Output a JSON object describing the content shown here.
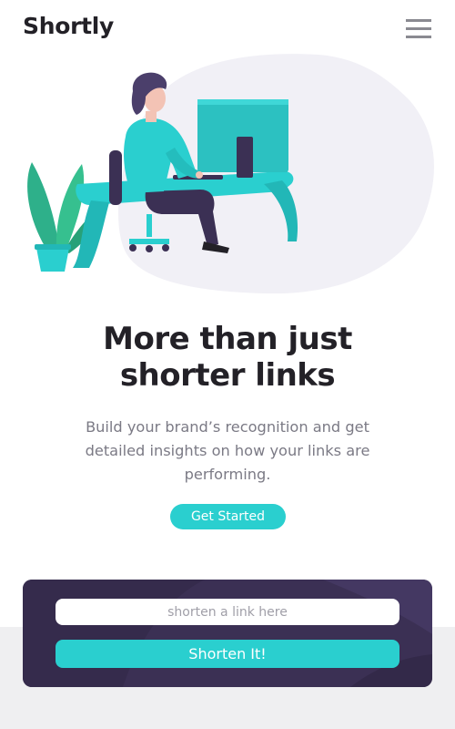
{
  "header": {
    "logo_text": "Shortly",
    "menu_icon": "hamburger-menu-icon"
  },
  "hero": {
    "illustration": "person-working-at-desk-illustration",
    "title_line1": "More than just",
    "title_line2": "shorter links",
    "description": "Build your brand’s recognition and get detailed insights on how your links are performing.",
    "cta_label": "Get Started"
  },
  "shorten": {
    "placeholder": "shorten a link here",
    "value": "",
    "button_label": "Shorten It!"
  },
  "colors": {
    "accent_cyan": "#2acfcf",
    "dark_violet": "#3b3054",
    "heading_dark": "#232127",
    "text_gray": "#7b7a85",
    "band_gray": "#efeff1"
  }
}
